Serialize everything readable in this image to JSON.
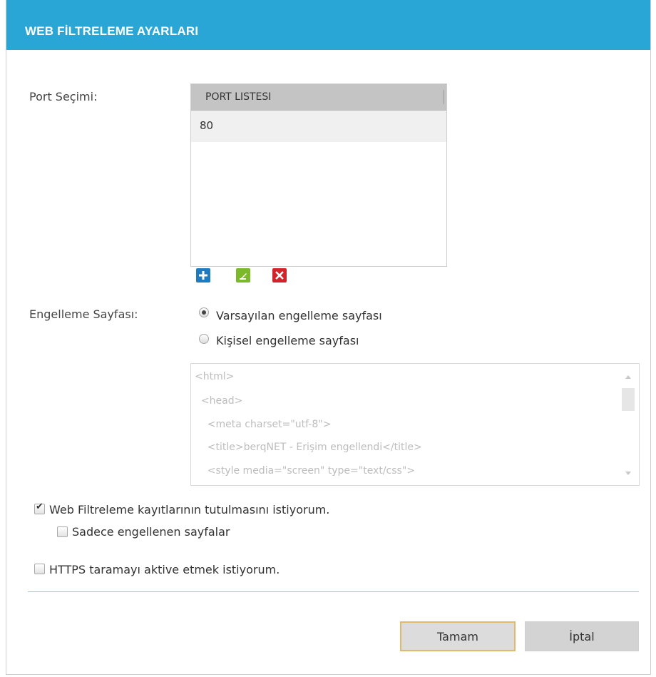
{
  "dialog": {
    "title": "WEB FİLTRELEME AYARLARI"
  },
  "port_section": {
    "label": "Port Seçimi:",
    "list_header": "PORT LISTESI",
    "ports": [
      "80"
    ]
  },
  "toolbar": {
    "add_icon": "plus-icon",
    "edit_icon": "edit-icon",
    "delete_icon": "x-icon"
  },
  "block_page": {
    "label": "Engelleme Sayfası:",
    "option_default": "Varsayılan engelleme sayfası",
    "option_custom": "Kişisel engelleme sayfası",
    "selected": "default",
    "code_lines": [
      "<html>",
      "  <head>",
      "    <meta charset=\"utf-8\">",
      "    <title>berqNET - Erişim engellendi</title>",
      "    <style media=\"screen\" type=\"text/css\">"
    ]
  },
  "options": {
    "logging_label": "Web Filtreleme kayıtlarının tutulmasını istiyorum.",
    "logging_checked": true,
    "only_blocked_label": "Sadece engellenen sayfalar",
    "only_blocked_checked": false,
    "https_label": "HTTPS taramayı aktive etmek istiyorum.",
    "https_checked": false
  },
  "buttons": {
    "ok": "Tamam",
    "cancel": "İptal"
  },
  "colors": {
    "titlebar": "#2aa6d6",
    "add": "#1f7bbf",
    "edit": "#7bb82b",
    "delete": "#d2232a",
    "ok_border": "#e4b86a"
  }
}
